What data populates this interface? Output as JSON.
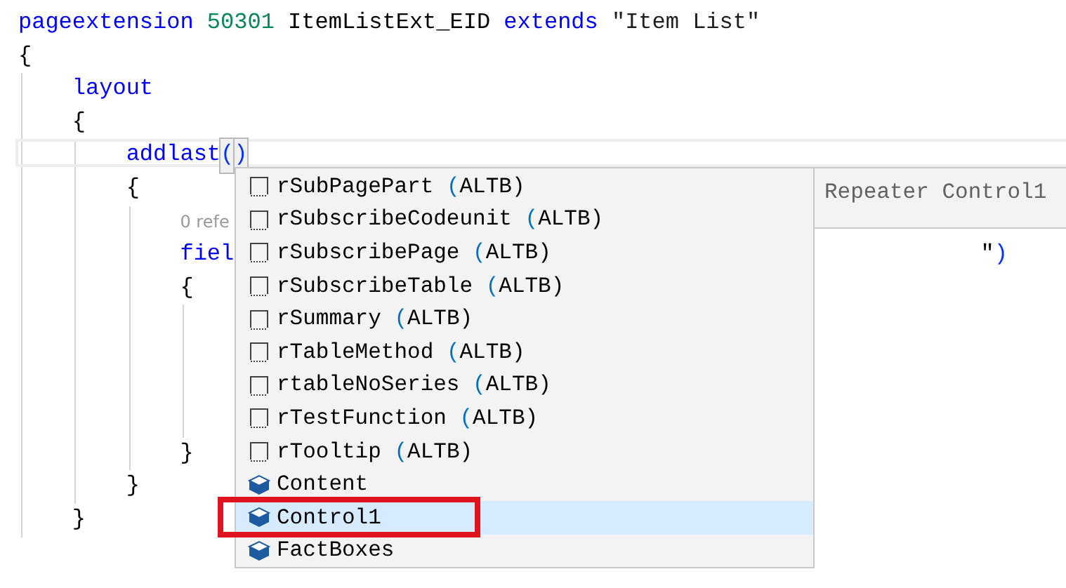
{
  "code": [
    {
      "kind": "line",
      "tokens": [
        {
          "text": "pageextension",
          "kind": "keyword"
        },
        {
          "text": "50301",
          "kind": "number"
        },
        {
          "text": "ItemListExt_EID",
          "kind": "plain"
        },
        {
          "text": "extends",
          "kind": "keyword"
        },
        {
          "text": "\"Item List\"",
          "kind": "string"
        }
      ]
    },
    {
      "kind": "block",
      "open": "{",
      "children": [
        {
          "kind": "line",
          "tokens": [
            {
              "text": "layout",
              "kind": "keyword"
            }
          ]
        },
        {
          "kind": "block",
          "open": "{",
          "close": "}",
          "children": [
            {
              "kind": "line",
              "current": true,
              "tokens": [
                {
                  "text": "addlast",
                  "kind": "keyword"
                },
                {
                  "text": "(",
                  "kind": "bracket",
                  "cursor": true
                },
                {
                  "text": ")",
                  "kind": "bracket",
                  "cursor": false
                }
              ]
            },
            {
              "kind": "block",
              "open": "{",
              "close": "}",
              "children": [
                {
                  "kind": "lens",
                  "text": "0 refe"
                },
                {
                  "kind": "line",
                  "tokens": [
                    {
                      "text": "fiel",
                      "kind": "keyword"
                    }
                  ],
                  "tail": [
                    {
                      "text": "\"",
                      "kind": "plain"
                    },
                    {
                      "text": ")",
                      "kind": "bracket"
                    }
                  ]
                },
                {
                  "kind": "block",
                  "open": "{",
                  "close": "}",
                  "children": [
                    {
                      "kind": "blank"
                    },
                    {
                      "kind": "blank"
                    },
                    {
                      "kind": "blank"
                    },
                    {
                      "kind": "blank"
                    }
                  ]
                }
              ]
            }
          ]
        }
      ]
    }
  ],
  "suggest": {
    "items": [
      {
        "kind": "snippet",
        "label": "rSubPagePart",
        "detail": "(ALTB)",
        "selected": false,
        "annotated": false
      },
      {
        "kind": "snippet",
        "label": "rSubscribeCodeunit",
        "detail": "(ALTB)",
        "selected": false,
        "annotated": false
      },
      {
        "kind": "snippet",
        "label": "rSubscribePage",
        "detail": "(ALTB)",
        "selected": false,
        "annotated": false
      },
      {
        "kind": "snippet",
        "label": "rSubscribeTable",
        "detail": "(ALTB)",
        "selected": false,
        "annotated": false
      },
      {
        "kind": "snippet",
        "label": "rSummary",
        "detail": "(ALTB)",
        "selected": false,
        "annotated": false
      },
      {
        "kind": "snippet",
        "label": "rTableMethod",
        "detail": "(ALTB)",
        "selected": false,
        "annotated": false
      },
      {
        "kind": "snippet",
        "label": "rtableNoSeries",
        "detail": "(ALTB)",
        "selected": false,
        "annotated": false
      },
      {
        "kind": "snippet",
        "label": "rTestFunction",
        "detail": "(ALTB)",
        "selected": false,
        "annotated": false
      },
      {
        "kind": "snippet",
        "label": "rTooltip",
        "detail": "(ALTB)",
        "selected": false,
        "annotated": false
      },
      {
        "kind": "control",
        "label": "Content",
        "selected": false,
        "annotated": false
      },
      {
        "kind": "control",
        "label": "Control1",
        "selected": true,
        "annotated": true
      },
      {
        "kind": "control",
        "label": "FactBoxes",
        "selected": false,
        "annotated": false
      }
    ],
    "details": "Repeater Control1"
  }
}
